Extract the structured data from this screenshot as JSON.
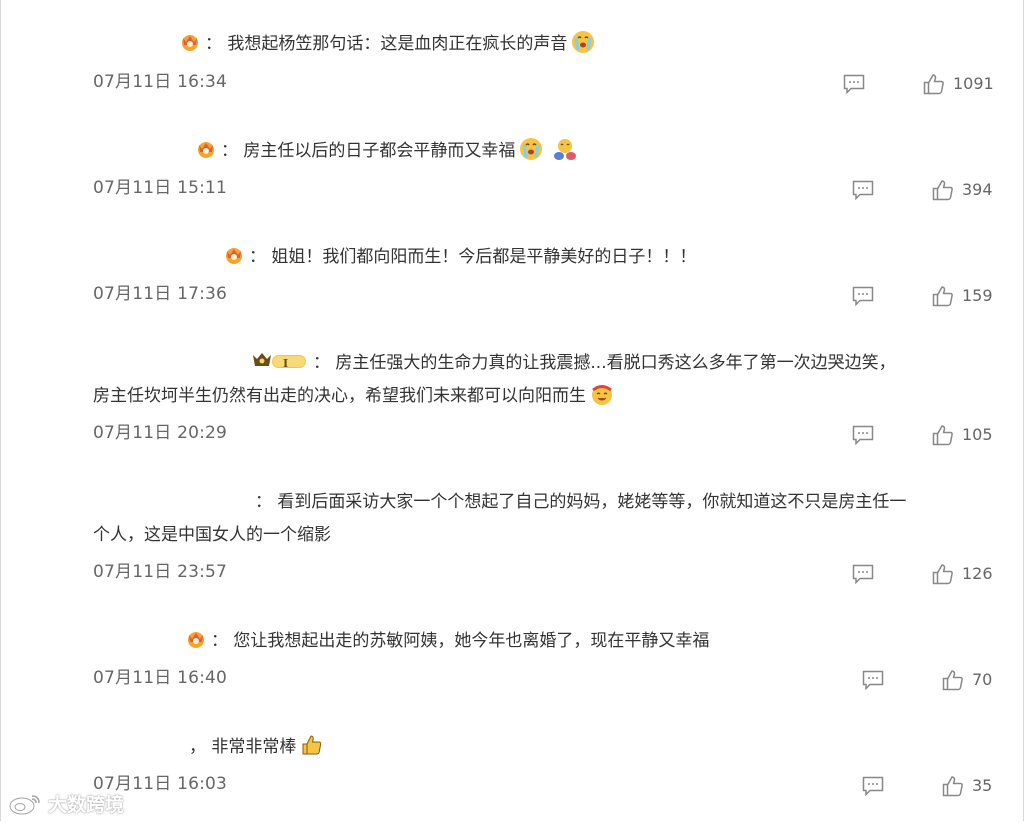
{
  "comments": [
    {
      "text": "： 我想起杨笠那句话：这是血肉正在疯长的声音",
      "text2": "",
      "time": "07月11日 16:34",
      "likes": "1091",
      "badge": "crown-badge",
      "emojis": [
        "crying-face"
      ]
    },
    {
      "text": "： 房主任以后的日子都会平静而又幸福",
      "text2": "",
      "time": "07月11日 15:11",
      "likes": "394",
      "badge": "crown-badge",
      "emojis": [
        "crying-face",
        "hug-face"
      ]
    },
    {
      "text": "： 姐姐！我们都向阳而生！今后都是平静美好的日子！！！",
      "text2": "",
      "time": "07月11日 17:36",
      "likes": "159",
      "badge": "crown-badge",
      "emojis": []
    },
    {
      "text": "： 房主任强大的生命力真的让我震撼...看脱口秀这么多年了第一次边哭边笑，",
      "text2": "房主任坎坷半生仍然有出走的决心，希望我们未来都可以向阳而生",
      "time": "07月11日 20:29",
      "likes": "105",
      "badge": "vip-badge",
      "vip_level": "I",
      "emojis": [
        "cheer-face"
      ]
    },
    {
      "text": "： 看到后面采访大家一个个想起了自己的妈妈，姥姥等等，你就知道这不只是房主任一",
      "text2": "个人，这是中国女人的一个缩影",
      "time": "07月11日 23:57",
      "likes": "126",
      "badge": "",
      "emojis": []
    },
    {
      "text": "： 您让我想起出走的苏敏阿姨，她今年也离婚了，现在平静又幸福",
      "text2": "",
      "time": "07月11日 16:40",
      "likes": "70",
      "badge": "crown-badge",
      "emojis": []
    },
    {
      "text": "， 非常非常棒",
      "text2": "",
      "time": "07月11日 16:03",
      "likes": "35",
      "badge": "",
      "emojis": [
        "thumbs-up"
      ]
    }
  ],
  "watermark": {
    "text": "大数跨境",
    "icon": "weibo-logo-icon"
  },
  "colors": {
    "text": "#333333",
    "meta": "#666666",
    "icon": "#888888",
    "badge": "#f3a62a"
  }
}
